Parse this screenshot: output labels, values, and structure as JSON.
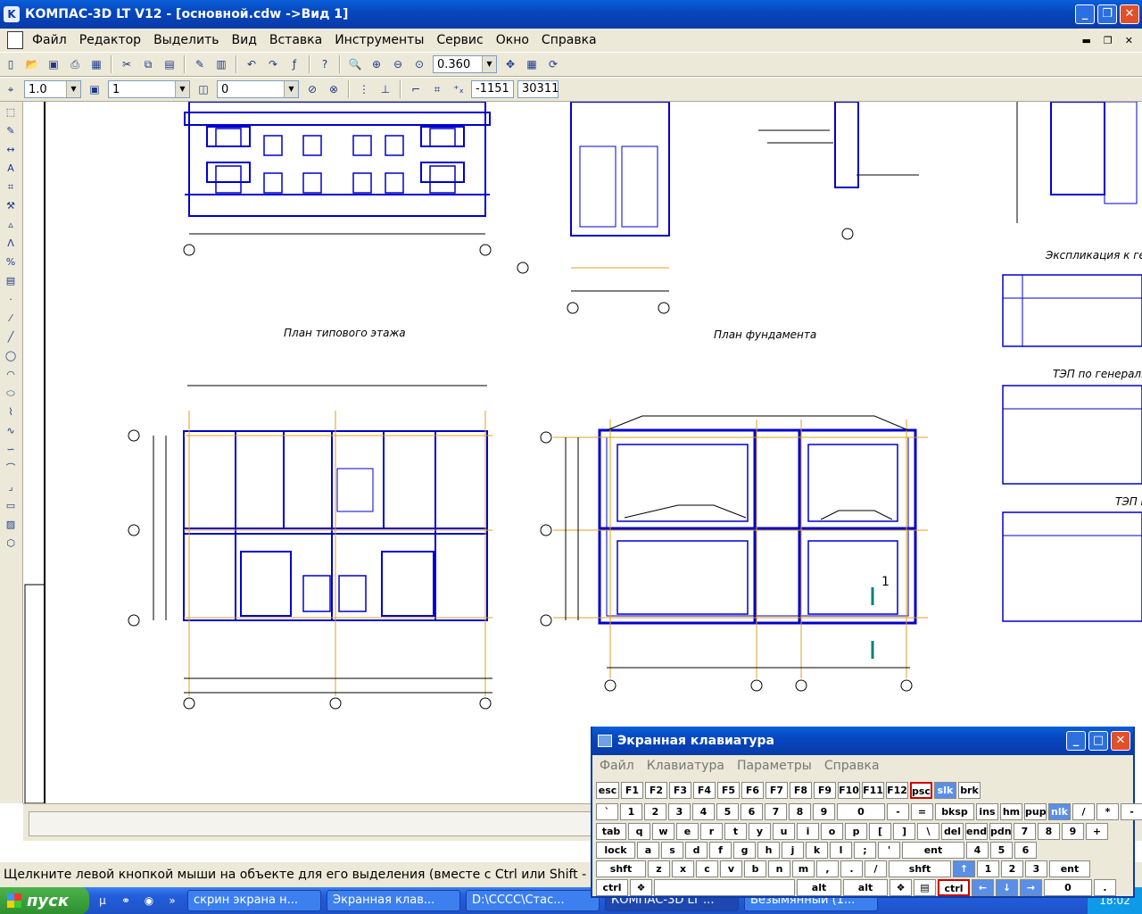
{
  "window": {
    "title": "КОМПАС-3D LT V12 - [основной.cdw ->Вид 1]"
  },
  "menu": [
    "Файл",
    "Редактор",
    "Выделить",
    "Вид",
    "Вставка",
    "Инструменты",
    "Сервис",
    "Окно",
    "Справка"
  ],
  "toolbar1": {
    "zoom": "0.360"
  },
  "toolbar2": {
    "step": "1.0",
    "layer": "1",
    "state": "0",
    "coord_x": "-1151",
    "coord_y": "30311"
  },
  "drawing": {
    "labels": {
      "plan_floor": "План типового этажа",
      "plan_foundation": "План фундамента",
      "explication": "Экспликация к ген",
      "tep_general": "ТЭП по генеральн",
      "tep_2": "ТЭП п"
    },
    "section_mark": "1"
  },
  "status": {
    "text": "Щелкните левой кнопкой мыши на объекте для его выделения (вместе с Ctrl или Shift - добавить к вы"
  },
  "taskbar": {
    "start": "пуск",
    "tasks": [
      "скрин экрана н...",
      "Экранная клав...",
      "D:\\СССС\\Стас...",
      "КОМПАС-3D LT ...",
      "Безымянный (1..."
    ],
    "clock": "18:02"
  },
  "osk": {
    "title": "Экранная клавиатура",
    "menu": [
      "Файл",
      "Клавиатура",
      "Параметры",
      "Справка"
    ],
    "rows": [
      [
        "esc",
        "F1",
        "F2",
        "F3",
        "F4",
        "F5",
        "F6",
        "F7",
        "F8",
        "F9",
        "F10",
        "F11",
        "F12",
        "psc",
        "slk",
        "brk"
      ],
      [
        "`",
        "1",
        "2",
        "3",
        "4",
        "5",
        "6",
        "7",
        "8",
        "9",
        "0",
        "-",
        "=",
        "bksp",
        "ins",
        "hm",
        "pup",
        "nlk",
        "/",
        "*",
        "-"
      ],
      [
        "tab",
        "q",
        "w",
        "e",
        "r",
        "t",
        "y",
        "u",
        "i",
        "o",
        "p",
        "[",
        "]",
        "\\",
        "del",
        "end",
        "pdn",
        "7",
        "8",
        "9",
        "+"
      ],
      [
        "lock",
        "a",
        "s",
        "d",
        "f",
        "g",
        "h",
        "j",
        "k",
        "l",
        ";",
        "'",
        "ent",
        "4",
        "5",
        "6"
      ],
      [
        "shft",
        "z",
        "x",
        "c",
        "v",
        "b",
        "n",
        "m",
        ",",
        ".",
        "/",
        "shft",
        "↑",
        "1",
        "2",
        "3",
        "ent"
      ],
      [
        "ctrl",
        "❖",
        "alt",
        "alt",
        "❖",
        "▤",
        "ctrl",
        "←",
        "↓",
        "→",
        "0",
        "."
      ]
    ]
  }
}
